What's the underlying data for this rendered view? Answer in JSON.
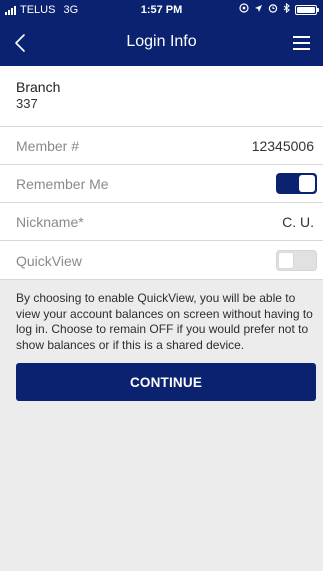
{
  "status_bar": {
    "carrier": "TELUS",
    "network": "3G",
    "time": "1:57 PM",
    "icons": [
      "location-icon",
      "navigation-arrow-icon",
      "alarm-icon",
      "bluetooth-icon",
      "battery-icon"
    ]
  },
  "nav": {
    "title": "Login Info",
    "back_icon": "chevron-left-icon",
    "menu_icon": "hamburger-menu-icon"
  },
  "branch": {
    "label": "Branch",
    "value": "337"
  },
  "member": {
    "label": "Member #",
    "value": "12345006"
  },
  "remember_me": {
    "label": "Remember Me",
    "enabled": true
  },
  "nickname": {
    "label": "Nickname*",
    "value": "C. U."
  },
  "quickview": {
    "label": "QuickView",
    "enabled": false
  },
  "info_text": "By choosing to enable QuickView, you will be able to view your account balances on screen without having to log in. Choose to remain OFF if you would prefer not to show balances or if this is a shared device.",
  "continue_label": "CONTINUE",
  "colors": {
    "brand": "#0b2270",
    "background": "#ececec",
    "row_background": "#ffffff"
  }
}
